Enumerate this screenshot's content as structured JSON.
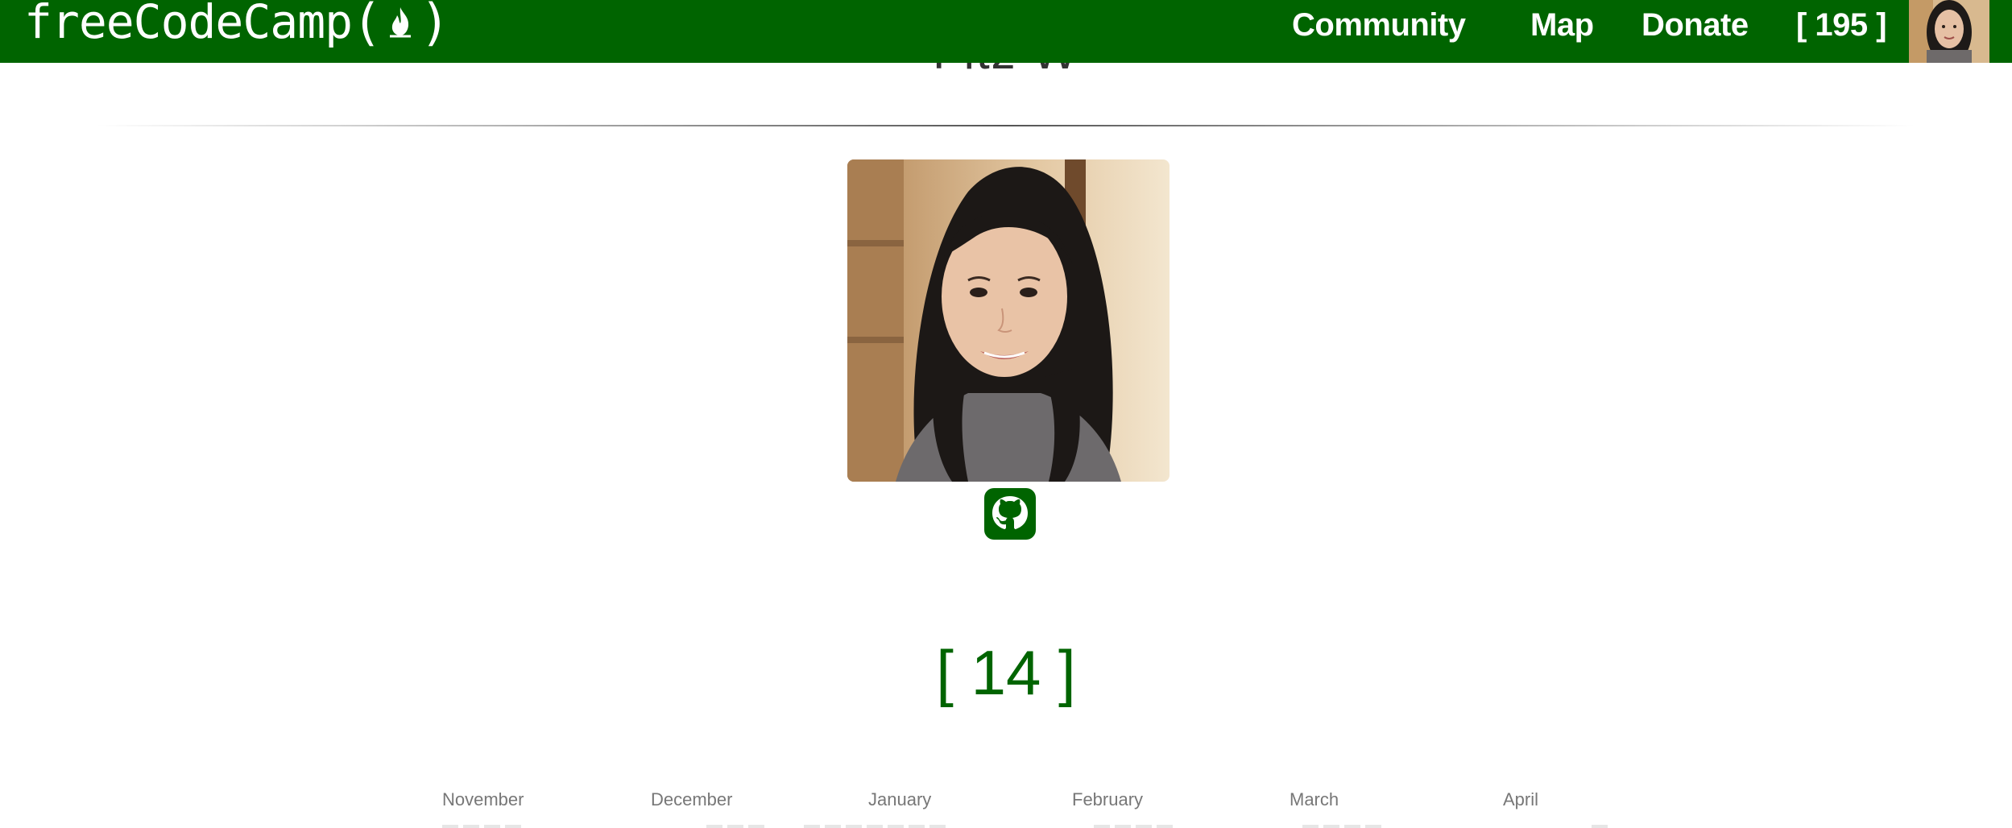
{
  "navbar": {
    "brand": "freeCodeCamp",
    "brand_open": "(",
    "brand_close": ")",
    "links": {
      "community": "Community",
      "map": "Map",
      "donate": "Donate",
      "points": "[ 195 ]"
    }
  },
  "profile": {
    "name": "Fitz W",
    "points": "[ 14 ]"
  },
  "heatmap": {
    "months": [
      "November",
      "December",
      "January",
      "February",
      "March",
      "April"
    ]
  },
  "colors": {
    "brand_green": "#006400",
    "background": "#ffffff"
  }
}
